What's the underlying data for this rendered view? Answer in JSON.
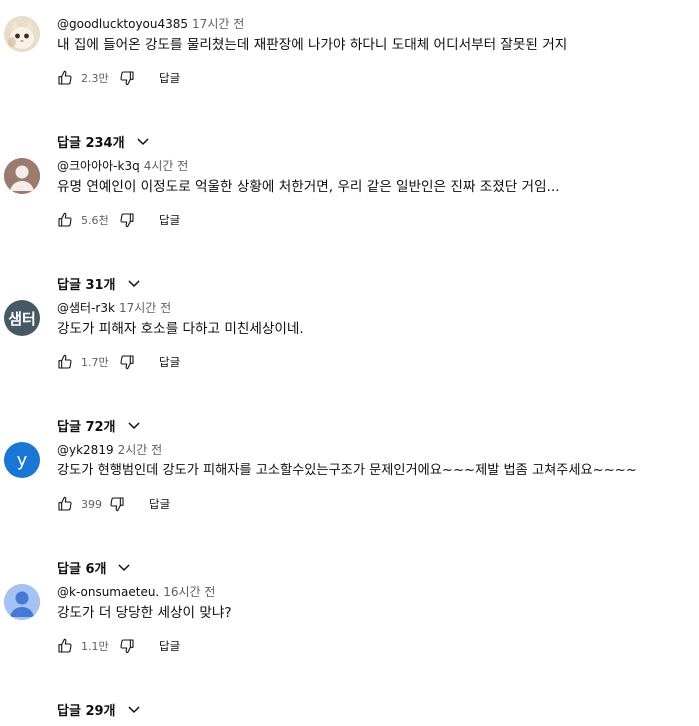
{
  "reply_label": "답글",
  "comments": [
    {
      "author": "@goodlucktoyou4385",
      "time": "17시간 전",
      "text": "내 집에 들어온 강도를 물리쳤는데 재판장에 나가야 하다니 도대체 어디서부터 잘못된 거지",
      "likes": "2.3만",
      "replies_label": "답글 234개",
      "avatar": {
        "type": "photo",
        "color": "#e9dcc8"
      }
    },
    {
      "author": "@크아아아-k3q",
      "time": "4시간 전",
      "text": "유명 연예인이 이정도로 억울한 상황에 처한거면, 우리 같은 일반인은 진짜 조졌단 거임...",
      "likes": "5.6천",
      "replies_label": "답글 31개",
      "avatar": {
        "type": "default",
        "color": "#9a7b6f"
      }
    },
    {
      "author": "@샘터-r3k",
      "time": "17시간 전",
      "text": "강도가 피해자 호소를 다하고 미친세상이네.",
      "likes": "1.7만",
      "replies_label": "답글 72개",
      "avatar": {
        "type": "text",
        "text": "샘터",
        "color": "#455a64"
      }
    },
    {
      "author": "@yk2819",
      "time": "2시간 전",
      "text": "강도가 현행범인데 강도가 피해자를 고소할수있는구조가 문제인거에요~~~제발 법좀 고쳐주세요~~~~",
      "likes": "399",
      "replies_label": "답글 6개",
      "avatar": {
        "type": "letter",
        "text": "y",
        "color": "#1976d2"
      }
    },
    {
      "author": "@k-onsumaeteu.",
      "time": "16시간 전",
      "text": "강도가 더 당당한 세상이 맞냐?",
      "likes": "1.1만",
      "replies_label": "답글 29개",
      "avatar": {
        "type": "default",
        "color": "#a4c2f4",
        "figure_color": "#4479d4"
      }
    }
  ]
}
